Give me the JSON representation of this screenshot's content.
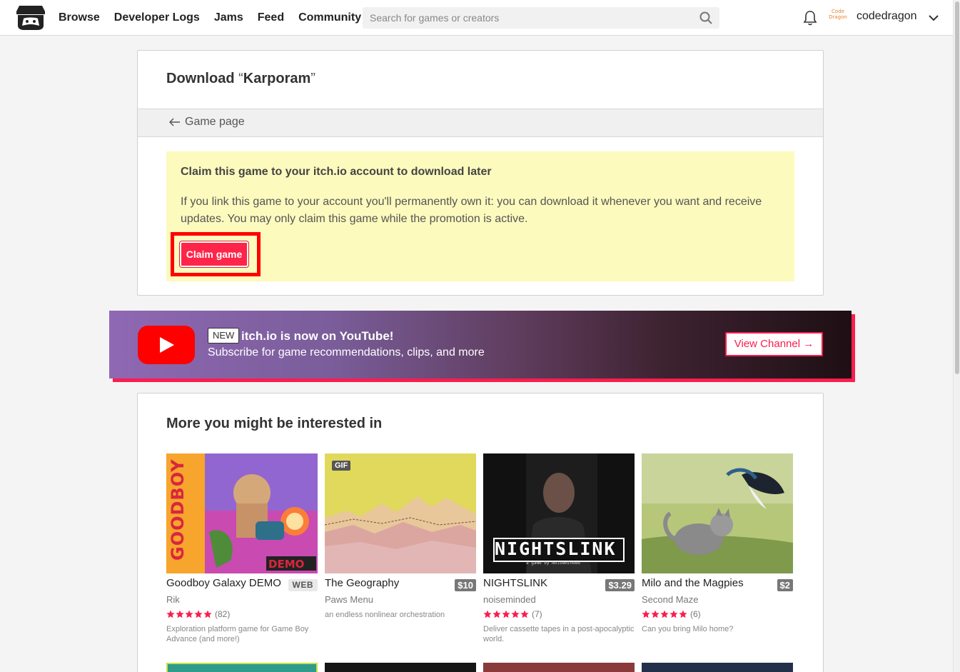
{
  "header": {
    "nav": [
      "Browse",
      "Developer Logs",
      "Jams",
      "Feed",
      "Community"
    ],
    "search_placeholder": "Search for games or creators",
    "username": "codedragon",
    "avatar_text": "Code Dragon"
  },
  "download": {
    "title_prefix": "Download",
    "open_quote": "“",
    "game_name": "Karporam",
    "close_quote": "”",
    "back_label": "Game page",
    "claim_heading": "Claim this game to your itch.io account to download later",
    "claim_text": "If you link this game to your account you'll permanently own it: you can download it whenever you want and receive updates. You may only claim this game while the promotion is active.",
    "claim_button": "Claim game"
  },
  "youtube_banner": {
    "badge": "NEW",
    "title": "itch.io is now on YouTube!",
    "subtitle": "Subscribe for game recommendations, clips, and more",
    "button": "View Channel →"
  },
  "recommendations": {
    "title": "More you might be interested in",
    "games": [
      {
        "title": "Goodboy Galaxy DEMO",
        "badge": "WEB",
        "author": "Rik",
        "stars": 5,
        "rating_count": "(82)",
        "description": "Exploration platform game for Game Boy Advance (and more!)",
        "thumb_text": "GOODBOY GALAXY",
        "thumb_tag": "DEMO"
      },
      {
        "title": "The Geography",
        "price": "$10",
        "author": "Paws Menu",
        "description": "an endless nonlinear orchestration",
        "gif": "GIF"
      },
      {
        "title": "NIGHTSLINK",
        "price": "$3.29",
        "author": "noiseminded",
        "stars": 5,
        "rating_count": "(7)",
        "description": "Deliver cassette tapes in a post-apocalyptic world.",
        "thumb_text": "NIGHTSLINK",
        "thumb_sub": "a game by Noiseminded"
      },
      {
        "title": "Milo and the Magpies",
        "price": "$2",
        "author": "Second Maze",
        "stars": 5,
        "rating_count": "(6)",
        "description": "Can you bring Milo home?"
      }
    ]
  },
  "colors": {
    "accent": "#fa1d4d",
    "claim_bg": "#fcfabd",
    "highlight": "#ff0000"
  }
}
